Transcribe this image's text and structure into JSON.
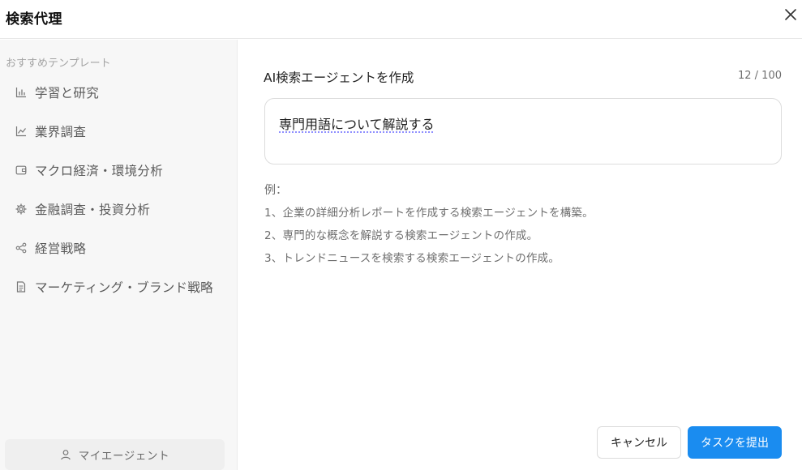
{
  "header": {
    "title": "検索代理",
    "close_icon": "close-icon"
  },
  "sidebar": {
    "heading": "おすすめテンプレート",
    "items": [
      {
        "label": "学習と研究",
        "icon": "bar-chart-icon"
      },
      {
        "label": "業界調査",
        "icon": "line-chart-icon"
      },
      {
        "label": "マクロ経済・環境分析",
        "icon": "wallet-icon"
      },
      {
        "label": "金融調査・投資分析",
        "icon": "gear-icon"
      },
      {
        "label": "経営戦略",
        "icon": "share-icon"
      },
      {
        "label": "マーケティング・ブランド戦略",
        "icon": "document-icon"
      }
    ],
    "my_agent": {
      "label": "マイエージェント",
      "icon": "user-icon"
    }
  },
  "main": {
    "form_label": "AI検索エージェントを作成",
    "char_count": "12 / 100",
    "input_value": "専門用語について解説する",
    "examples": {
      "heading": "例：",
      "lines": [
        "1、企業の詳細分析レポートを作成する検索エージェントを構築。",
        "2、専門的な概念を解説する検索エージェントの作成。",
        "3、トレンドニュースを検索する検索エージェントの作成。"
      ]
    },
    "cancel_label": "キャンセル",
    "submit_label": "タスクを提出"
  },
  "colors": {
    "accent": "#1a8cf0",
    "sidebar_bg": "#f7f7f7"
  }
}
